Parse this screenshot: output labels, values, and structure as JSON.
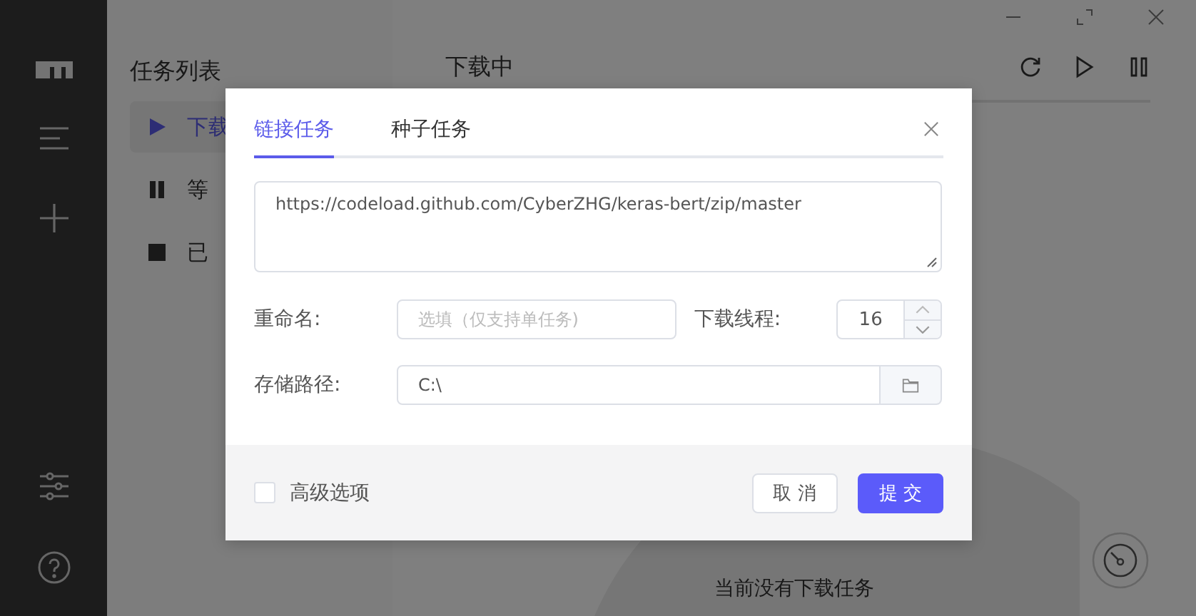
{
  "app": {
    "list_title": "任务列表",
    "list_items": [
      {
        "label": "下载",
        "kind": "play",
        "selected": true
      },
      {
        "label": "等",
        "kind": "pause",
        "selected": false
      },
      {
        "label": "已",
        "kind": "stop",
        "selected": false
      }
    ],
    "main_title": "下载中",
    "empty_text": "当前没有下载任务"
  },
  "dialog": {
    "tabs": [
      {
        "label": "链接任务",
        "selected": true
      },
      {
        "label": "种子任务",
        "selected": false
      }
    ],
    "url": "https://codeload.github.com/CyberZHG/keras-bert/zip/master",
    "rename": {
      "label": "重命名:",
      "placeholder": "选填（仅支持单任务)"
    },
    "threads": {
      "label": "下载线程:",
      "value": "16"
    },
    "path": {
      "label": "存储路径:",
      "value": "C:\\"
    },
    "advanced": {
      "label": "高级选项",
      "checked": false
    },
    "buttons": [
      {
        "label": "取 消",
        "kind": "secondary"
      },
      {
        "label": "提 交",
        "kind": "primary"
      }
    ]
  }
}
